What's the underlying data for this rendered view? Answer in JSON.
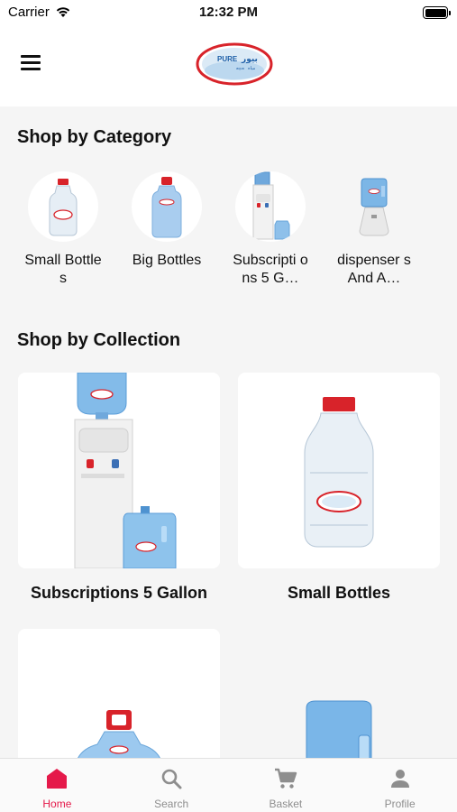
{
  "status_bar": {
    "carrier": "Carrier",
    "time": "12:32 PM"
  },
  "header": {
    "logo_text_en": "PURE",
    "logo_text_ar": "بيور",
    "logo_sub": "مياه",
    "logo_sub_en": "aqua"
  },
  "categories": {
    "title": "Shop by Category",
    "items": [
      {
        "label": "Small Bottles"
      },
      {
        "label": "Big Bottles"
      },
      {
        "label": "Subscripti ons 5 G…"
      },
      {
        "label": "dispenser s And A…"
      }
    ]
  },
  "collections": {
    "title": "Shop by Collection",
    "items": [
      {
        "label": "Subscriptions 5 Gallon"
      },
      {
        "label": "Small Bottles"
      },
      {
        "label": ""
      },
      {
        "label": ""
      }
    ]
  },
  "tabbar": {
    "tabs": [
      {
        "label": "Home",
        "icon": "home-icon"
      },
      {
        "label": "Search",
        "icon": "search-icon"
      },
      {
        "label": "Basket",
        "icon": "cart-icon"
      },
      {
        "label": "Profile",
        "icon": "profile-icon"
      }
    ],
    "active_color": "#e5194a",
    "inactive_color": "#8e8e8e"
  }
}
